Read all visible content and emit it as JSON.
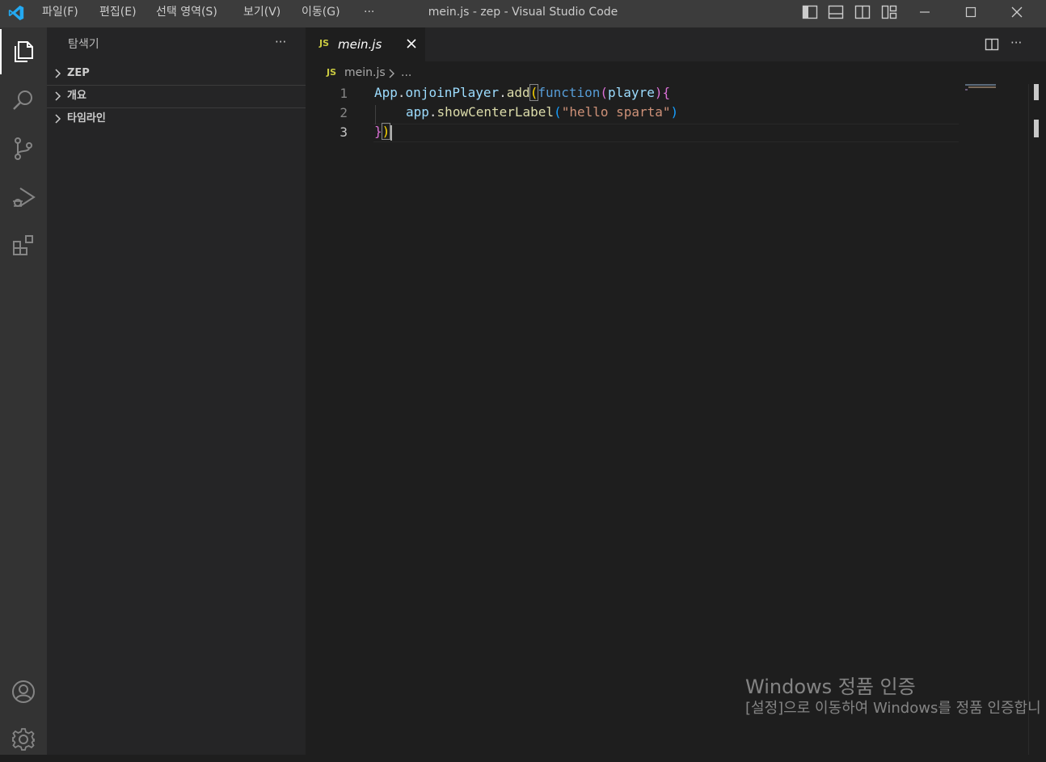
{
  "titlebar": {
    "window_title": "mein.js - zep - Visual Studio Code",
    "menus": [
      "파일(F)",
      "편집(E)",
      "선택 영역(S)",
      "보기(V)",
      "이동(G)"
    ],
    "more": "···",
    "layout_icons": [
      "toggle-primary-sidebar-icon",
      "toggle-panel-icon",
      "toggle-secondary-sidebar-icon",
      "customize-layout-icon"
    ],
    "window_controls": [
      "minimize-icon",
      "maximize-icon",
      "close-icon"
    ]
  },
  "activity_bar": {
    "items": [
      "explorer-icon",
      "search-icon",
      "source-control-icon",
      "run-debug-icon",
      "extensions-icon"
    ],
    "bottom": [
      "accounts-icon",
      "manage-gear-icon"
    ]
  },
  "sidebar": {
    "title": "탐색기",
    "more": "···",
    "sections": [
      "ZEP",
      "개요",
      "타임라인"
    ]
  },
  "editor": {
    "tab": {
      "file_badge": "JS",
      "label": "mein.js"
    },
    "breadcrumb": {
      "file_badge": "JS",
      "file": "mein.js",
      "more": "..."
    },
    "lines": [
      "1",
      "2",
      "3"
    ],
    "code": {
      "l1": [
        "App",
        ".",
        "onjoinPlayer",
        ".",
        "add",
        "(",
        "function",
        "(",
        "playre",
        ")",
        "{"
      ],
      "l2": [
        "app",
        ".",
        "showCenterLabel",
        "(",
        "\"hello sparta\"",
        ")"
      ],
      "l3": [
        "}",
        ")"
      ]
    }
  },
  "watermark": {
    "line1": "Windows 정품 인증",
    "line2": "[설정]으로 이동하여 Windows를 정품 인증합니"
  },
  "colors": {
    "titlebar_bg": "#3c3c3c",
    "activity_bg": "#333333",
    "sidebar_bg": "#252526",
    "editor_bg": "#1e1e1e",
    "vscode_blue": "#23a9f2",
    "js_badge": "#cbcb41"
  }
}
